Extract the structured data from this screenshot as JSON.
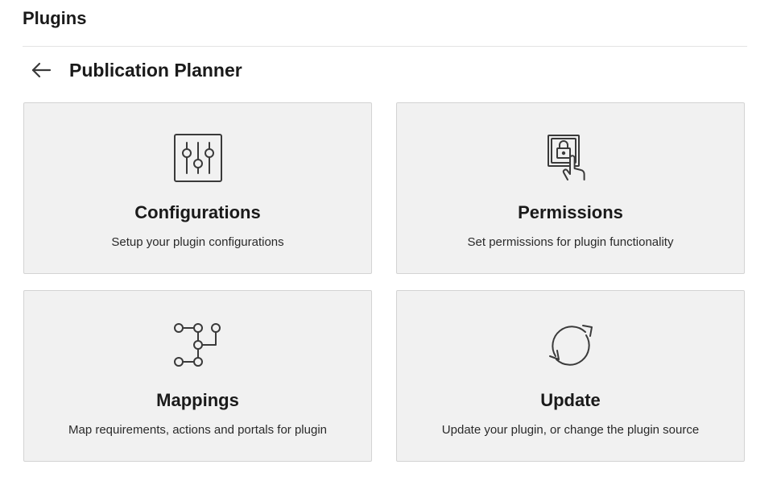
{
  "header": {
    "title": "Plugins"
  },
  "section": {
    "back_icon": "arrow-left-icon",
    "title": "Publication Planner"
  },
  "cards": [
    {
      "icon": "sliders-icon",
      "title": "Configurations",
      "description": "Setup your plugin configurations"
    },
    {
      "icon": "lock-touch-icon",
      "title": "Permissions",
      "description": "Set permissions for plugin functionality"
    },
    {
      "icon": "mapping-nodes-icon",
      "title": "Mappings",
      "description": "Map requirements, actions and portals for plugin"
    },
    {
      "icon": "refresh-icon",
      "title": "Update",
      "description": "Update your plugin, or change the plugin source"
    }
  ],
  "colors": {
    "card_background": "#f1f1f1",
    "card_border": "#d3d3d3",
    "icon_stroke": "#3a3a3a",
    "text": "#1a1a1a"
  }
}
